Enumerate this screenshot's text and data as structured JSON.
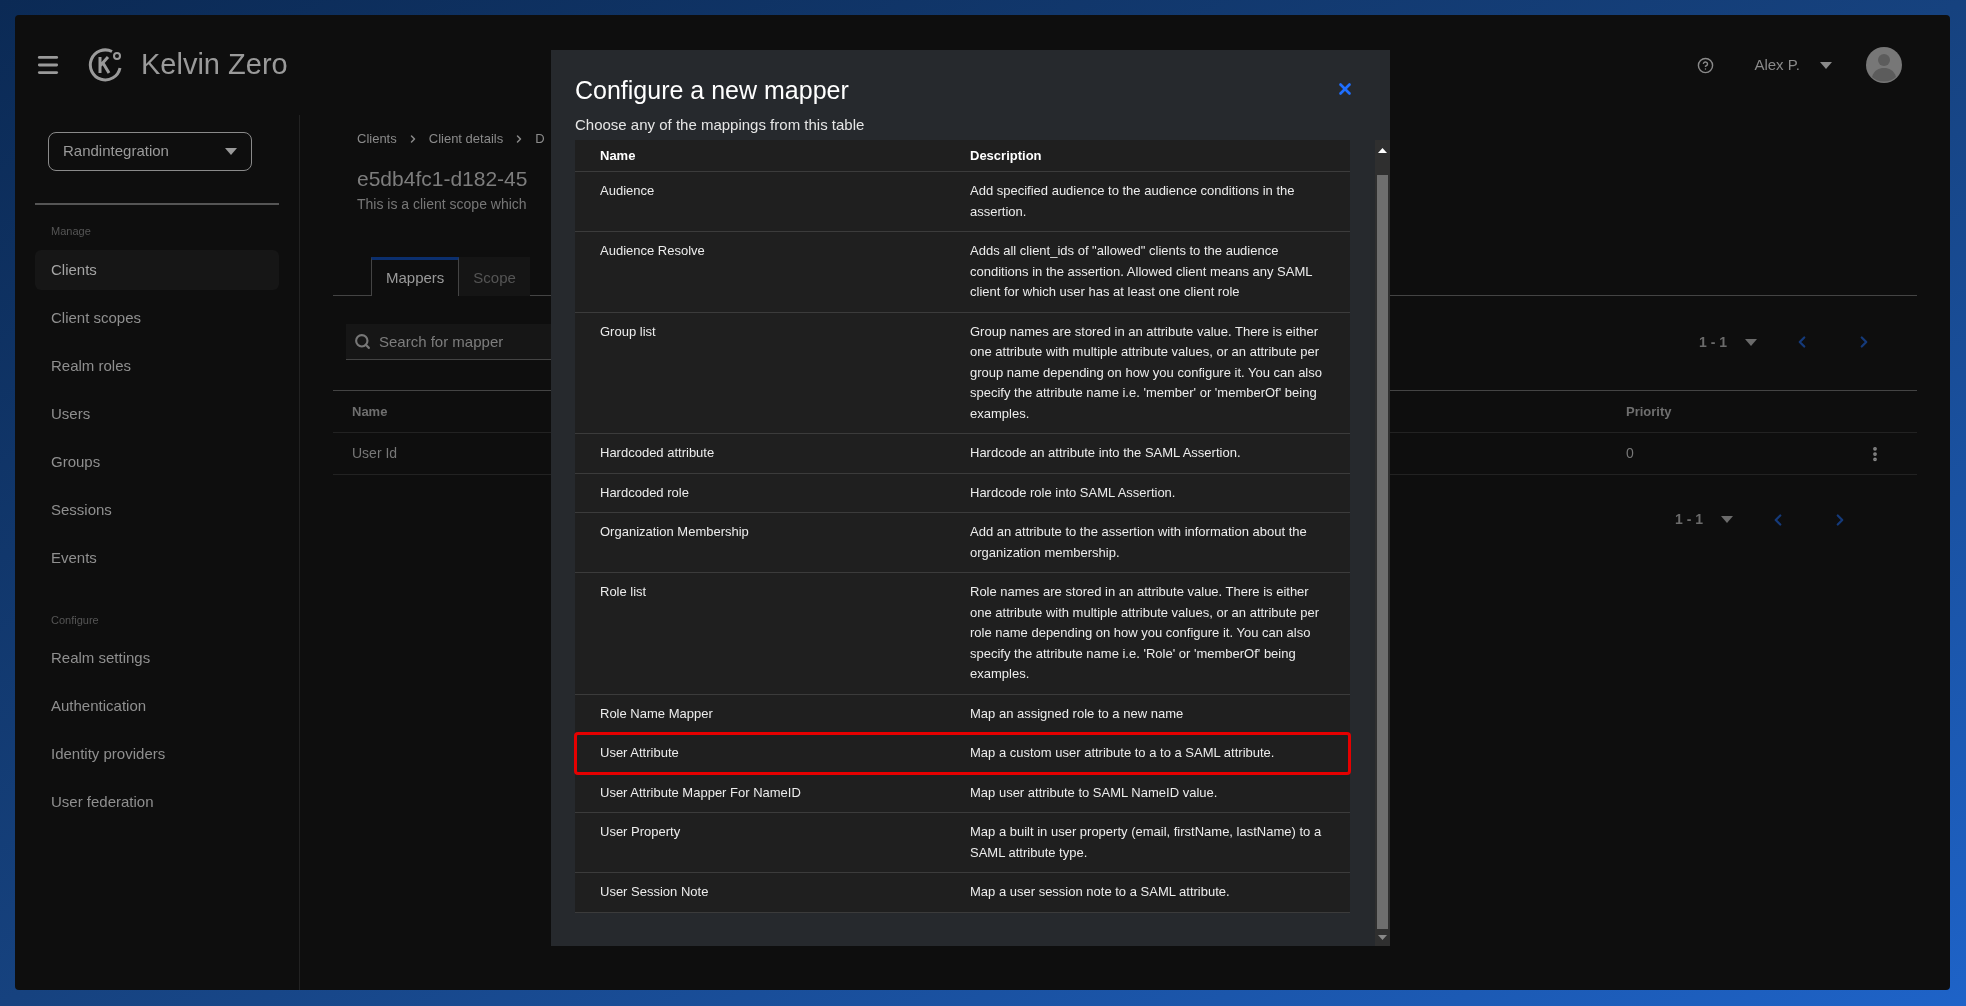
{
  "header": {
    "brand": "Kelvin Zero",
    "user": "Alex P."
  },
  "sidebar": {
    "realm": "Randintegration",
    "sections": [
      {
        "title": "Manage",
        "items": [
          {
            "label": "Clients",
            "selected": true
          },
          {
            "label": "Client scopes",
            "selected": false
          },
          {
            "label": "Realm roles",
            "selected": false
          },
          {
            "label": "Users",
            "selected": false
          },
          {
            "label": "Groups",
            "selected": false
          },
          {
            "label": "Sessions",
            "selected": false
          },
          {
            "label": "Events",
            "selected": false
          }
        ]
      },
      {
        "title": "Configure",
        "items": [
          {
            "label": "Realm settings",
            "selected": false
          },
          {
            "label": "Authentication",
            "selected": false
          },
          {
            "label": "Identity providers",
            "selected": false
          },
          {
            "label": "User federation",
            "selected": false
          }
        ]
      }
    ]
  },
  "page": {
    "breadcrumb": [
      "Clients",
      "Client details",
      "D"
    ],
    "title": "e5db4fc1-d182-45",
    "description": "This is a client scope which",
    "tabs": [
      {
        "label": "Mappers",
        "selected": true
      },
      {
        "label": "Scope",
        "selected": false
      }
    ],
    "search": {
      "placeholder": "Search for mapper"
    },
    "pagination": [
      "1 - 1",
      "1 - 1"
    ],
    "table": {
      "columns": [
        "Name",
        "Priority"
      ],
      "rows": [
        {
          "name": "User Id",
          "priority": "0"
        }
      ]
    }
  },
  "modal": {
    "title": "Configure a new mapper",
    "subtitle": "Choose any of the mappings from this table",
    "columns": [
      "Name",
      "Description"
    ],
    "rows": [
      {
        "name": "Audience",
        "description": "Add specified audience to the audience conditions in the assertion.",
        "highlighted": false
      },
      {
        "name": "Audience Resolve",
        "description": "Adds all client_ids of \"allowed\" clients to the audience conditions in the assertion. Allowed client means any SAML client for which user has at least one client role",
        "highlighted": false
      },
      {
        "name": "Group list",
        "description": "Group names are stored in an attribute value. There is either one attribute with multiple attribute values, or an attribute per group name depending on how you configure it. You can also specify the attribute name i.e. 'member' or 'memberOf' being examples.",
        "highlighted": false
      },
      {
        "name": "Hardcoded attribute",
        "description": "Hardcode an attribute into the SAML Assertion.",
        "highlighted": false
      },
      {
        "name": "Hardcoded role",
        "description": "Hardcode role into SAML Assertion.",
        "highlighted": false
      },
      {
        "name": "Organization Membership",
        "description": "Add an attribute to the assertion with information about the organization membership.",
        "highlighted": false
      },
      {
        "name": "Role list",
        "description": "Role names are stored in an attribute value. There is either one attribute with multiple attribute values, or an attribute per role name depending on how you configure it. You can also specify the attribute name i.e. 'Role' or 'memberOf' being examples.",
        "highlighted": false
      },
      {
        "name": "Role Name Mapper",
        "description": "Map an assigned role to a new name",
        "highlighted": false
      },
      {
        "name": "User Attribute",
        "description": "Map a custom user attribute to a to a SAML attribute.",
        "highlighted": true
      },
      {
        "name": "User Attribute Mapper For NameID",
        "description": "Map user attribute to SAML NameID value.",
        "highlighted": false
      },
      {
        "name": "User Property",
        "description": "Map a built in user property (email, firstName, lastName) to a SAML attribute type.",
        "highlighted": false
      },
      {
        "name": "User Session Note",
        "description": "Map a user session note to a SAML attribute.",
        "highlighted": false
      }
    ]
  }
}
